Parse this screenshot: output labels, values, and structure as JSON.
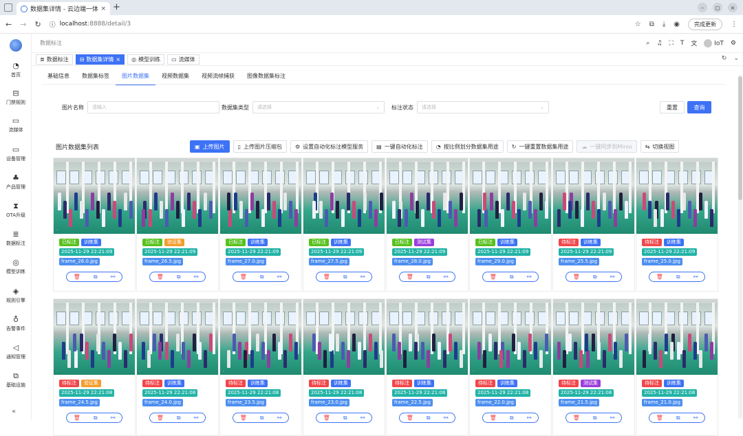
{
  "browser": {
    "tab_title": "数据集详情 - 云边端一体",
    "tab_close": "×",
    "new_tab": "+",
    "url_host": "localhost",
    "url_path": ":8888/detail/3",
    "update_button": "完成更新",
    "win_buttons": [
      "–",
      "◻",
      "×"
    ]
  },
  "sidebar": {
    "items": [
      {
        "label": "首页",
        "icon": "dashboard-icon",
        "glyph": "◔"
      },
      {
        "label": "门禁规则",
        "icon": "door-icon",
        "glyph": "⊟"
      },
      {
        "label": "流媒体",
        "icon": "video-icon",
        "glyph": "▭"
      },
      {
        "label": "设备管理",
        "icon": "monitor-icon",
        "glyph": "▭"
      },
      {
        "label": "产品管理",
        "icon": "cluster-icon",
        "glyph": "♣"
      },
      {
        "label": "OTA升级",
        "icon": "hourglass-icon",
        "glyph": "⧗"
      },
      {
        "label": "数据标注",
        "icon": "database-icon",
        "glyph": "≣"
      },
      {
        "label": "模型训练",
        "icon": "model-icon",
        "glyph": "◎"
      },
      {
        "label": "规则引擎",
        "icon": "rule-icon",
        "glyph": "◈"
      },
      {
        "label": "告警事件",
        "icon": "bell-icon",
        "glyph": "♁"
      },
      {
        "label": "通知管理",
        "icon": "notify-icon",
        "glyph": "◁"
      },
      {
        "label": "基础设施",
        "icon": "infra-icon",
        "glyph": "⧉"
      }
    ],
    "collapse": "«"
  },
  "topbar": {
    "breadcrumb": "数据标注",
    "user": "IoT"
  },
  "page_tabs": [
    {
      "label": "数据标注",
      "icon": "≣"
    },
    {
      "label": "数据集详情",
      "icon": "⊟",
      "close": "×"
    },
    {
      "label": "模型训练",
      "icon": "◎"
    },
    {
      "label": "流媒体",
      "icon": "▭"
    }
  ],
  "sub_tabs": [
    "基础信息",
    "数据集标签",
    "图片数据集",
    "视频数据集",
    "视频流帧捕获",
    "图像数据集标注"
  ],
  "filters": {
    "name_label": "图片名称",
    "name_placeholder": "请输入",
    "type_label": "数据集类型",
    "type_placeholder": "请选择",
    "status_label": "标注状态",
    "status_placeholder": "请选择",
    "reset": "重置",
    "query": "查询"
  },
  "list": {
    "title": "图片数据集列表",
    "actions": [
      {
        "label": "上传图片",
        "icon": "▣",
        "style": "primary"
      },
      {
        "label": "上传图片压缩包",
        "icon": "▯",
        "style": ""
      },
      {
        "label": "设置自动化标注模型服务",
        "icon": "⚙",
        "style": ""
      },
      {
        "label": "一键自动化标注",
        "icon": "▤",
        "style": ""
      },
      {
        "label": "按比例划分数据集用途",
        "icon": "◔",
        "style": ""
      },
      {
        "label": "一键重置数据集用途",
        "icon": "↻",
        "style": ""
      },
      {
        "label": "一键同步到Minio",
        "icon": "☁",
        "style": "disabled"
      },
      {
        "label": "切换视图",
        "icon": "⇆",
        "style": ""
      }
    ]
  },
  "cards": [
    {
      "status": "已标注",
      "status_class": "s1",
      "usage": "训练集",
      "usage_class": "u-train",
      "time": "2025-11-29 22:21:09",
      "file": "frame_26.0.jpg"
    },
    {
      "status": "已标注",
      "status_class": "s1",
      "usage": "验证集",
      "usage_class": "u-val",
      "time": "2025-11-29 22:21:09",
      "file": "frame_26.5.jpg"
    },
    {
      "status": "已标注",
      "status_class": "s1",
      "usage": "训练集",
      "usage_class": "u-train",
      "time": "2025-11-29 22:21:09",
      "file": "frame_27.0.jpg"
    },
    {
      "status": "已标注",
      "status_class": "s1",
      "usage": "训练集",
      "usage_class": "u-train",
      "time": "2025-11-29 22:21:09",
      "file": "frame_27.5.jpg"
    },
    {
      "status": "已标注",
      "status_class": "s1",
      "usage": "测试集",
      "usage_class": "u-test",
      "time": "2025-11-29 22:21:09",
      "file": "frame_28.0.jpg"
    },
    {
      "status": "已标注",
      "status_class": "s1",
      "usage": "训练集",
      "usage_class": "u-train",
      "time": "2025-11-29 22:21:09",
      "file": "frame_29.0.jpg"
    },
    {
      "status": "待标注",
      "status_class": "s0",
      "usage": "训练集",
      "usage_class": "u-train",
      "time": "2025-11-29 22:21:09",
      "file": "frame_25.5.jpg"
    },
    {
      "status": "待标注",
      "status_class": "s0",
      "usage": "训练集",
      "usage_class": "u-train",
      "time": "2025-11-29 22:21:09",
      "file": "frame_25.0.jpg"
    },
    {
      "status": "待标注",
      "status_class": "s0",
      "usage": "验证集",
      "usage_class": "u-val",
      "time": "2025-11-29 22:21:08",
      "file": "frame_24.5.jpg"
    },
    {
      "status": "待标注",
      "status_class": "s0",
      "usage": "训练集",
      "usage_class": "u-train",
      "time": "2025-11-29 22:21:08",
      "file": "frame_24.0.jpg"
    },
    {
      "status": "待标注",
      "status_class": "s0",
      "usage": "训练集",
      "usage_class": "u-train",
      "time": "2025-11-29 22:21:08",
      "file": "frame_23.5.jpg"
    },
    {
      "status": "待标注",
      "status_class": "s0",
      "usage": "训练集",
      "usage_class": "u-train",
      "time": "2025-11-29 22:21:08",
      "file": "frame_23.0.jpg"
    },
    {
      "status": "待标注",
      "status_class": "s0",
      "usage": "训练集",
      "usage_class": "u-train",
      "time": "2025-11-29 22:21:08",
      "file": "frame_22.5.jpg"
    },
    {
      "status": "待标注",
      "status_class": "s0",
      "usage": "训练集",
      "usage_class": "u-train",
      "time": "2025-11-29 22:21:08",
      "file": "frame_22.0.jpg"
    },
    {
      "status": "待标注",
      "status_class": "s0",
      "usage": "测试集",
      "usage_class": "u-test",
      "time": "2025-11-29 22:21:08",
      "file": "frame_21.5.jpg"
    },
    {
      "status": "待标注",
      "status_class": "s0",
      "usage": "训练集",
      "usage_class": "u-train",
      "time": "2025-11-29 22:21:08",
      "file": "frame_21.0.jpg"
    }
  ]
}
